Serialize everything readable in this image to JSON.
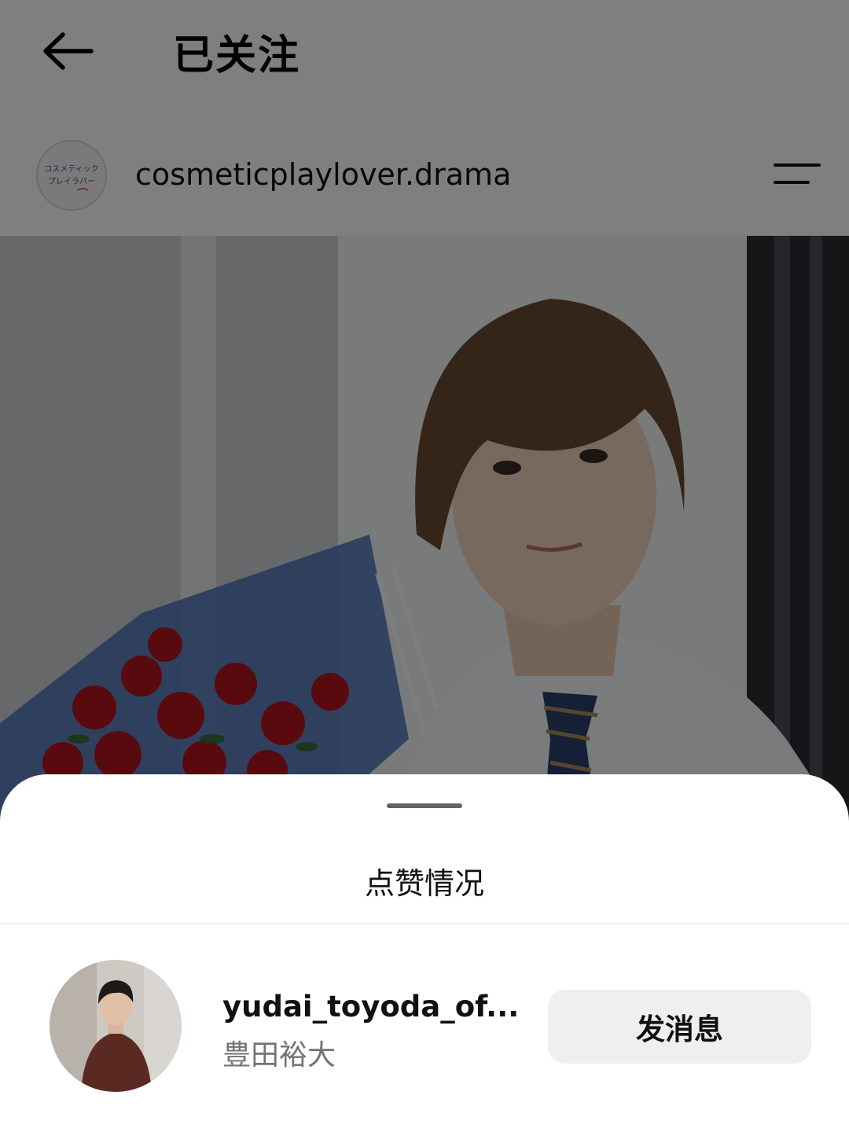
{
  "header": {
    "title": "已关注",
    "back_icon": "arrow-left-icon"
  },
  "post": {
    "account_name": "cosmeticplaylover.drama",
    "avatar_text_line1": "コスメティック",
    "avatar_text_line2": "プレイラバー",
    "menu_icon": "menu-lines-icon"
  },
  "likes_sheet": {
    "title": "点赞情况",
    "likers": [
      {
        "username": "yudai_toyoda_of...",
        "full_name": "豊田裕大",
        "button_label": "发消息"
      }
    ]
  },
  "colors": {
    "overlay": "rgba(0,0,0,0.5)",
    "button_bg": "#efeff2",
    "secondary_text": "#737373"
  }
}
